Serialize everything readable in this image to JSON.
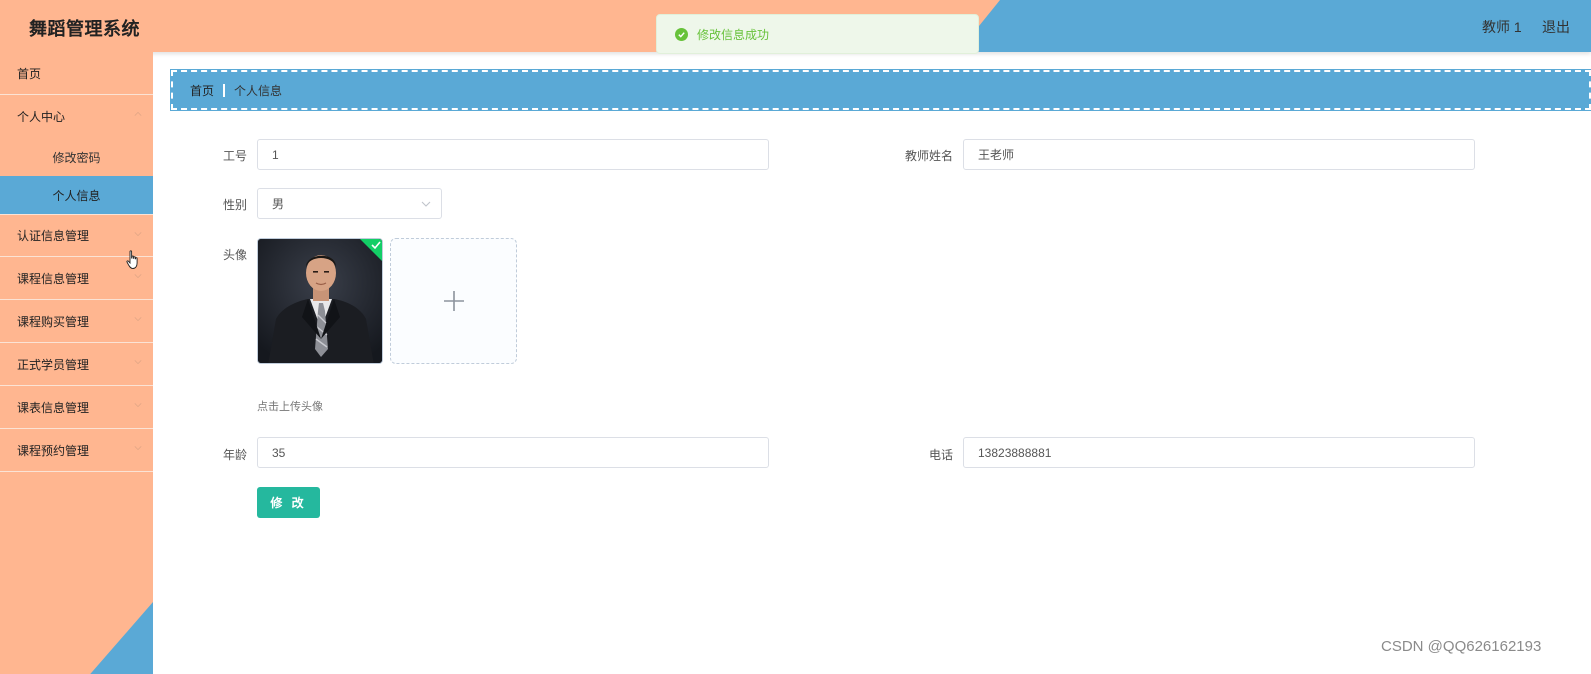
{
  "header": {
    "app_title": "舞蹈管理系统",
    "user_name": "教师 1",
    "logout_label": "退出"
  },
  "toast": {
    "message": "修改信息成功"
  },
  "sidebar": {
    "items": [
      {
        "label": "首页"
      },
      {
        "label": "个人中心",
        "submenu": [
          {
            "label": "修改密码"
          },
          {
            "label": "个人信息",
            "active": true
          }
        ]
      },
      {
        "label": "认证信息管理"
      },
      {
        "label": "课程信息管理"
      },
      {
        "label": "课程购买管理"
      },
      {
        "label": "正式学员管理"
      },
      {
        "label": "课表信息管理"
      },
      {
        "label": "课程预约管理"
      }
    ]
  },
  "breadcrumb": {
    "home": "首页",
    "current": "个人信息"
  },
  "form": {
    "employee_id": {
      "label": "工号",
      "value": "1"
    },
    "teacher_name": {
      "label": "教师姓名",
      "value": "王老师"
    },
    "gender": {
      "label": "性别",
      "value": "男"
    },
    "avatar": {
      "label": "头像",
      "upload_tip": "点击上传头像"
    },
    "age": {
      "label": "年龄",
      "value": "35"
    },
    "phone": {
      "label": "电话",
      "value": "13823888881"
    },
    "submit_label": "修 改"
  },
  "watermark": "CSDN @QQ626162193",
  "colors": {
    "orange": "#ffb690",
    "blue": "#5aa9d6",
    "success_green": "#67c23a",
    "button_teal": "#25b89e"
  }
}
